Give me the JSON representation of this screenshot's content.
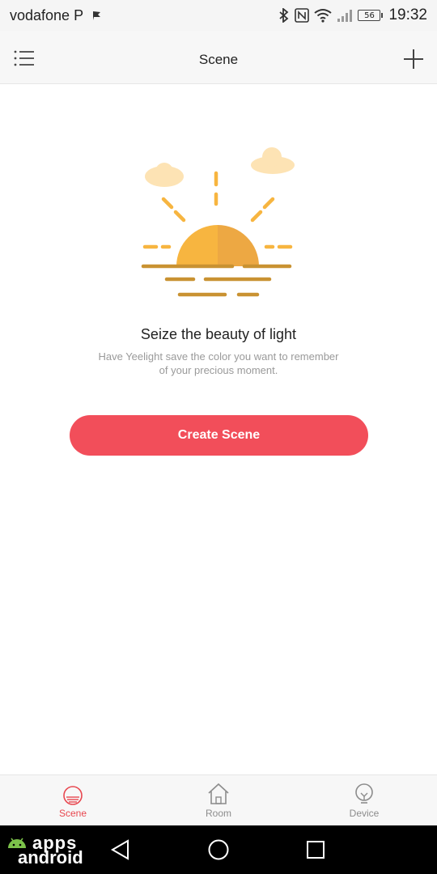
{
  "status_bar": {
    "carrier": "vodafone P",
    "battery_level": "56",
    "time": "19:32"
  },
  "header": {
    "title": "Scene",
    "menu_icon": "hamburger-menu-icon",
    "add_icon": "plus-icon"
  },
  "empty_state": {
    "illustration": "sunset-icon",
    "headline": "Seize the beauty of light",
    "description": "Have Yeelight save the color you want to remember of your precious moment."
  },
  "primary_action": {
    "label": "Create Scene"
  },
  "colors": {
    "accent": "#f24e5a",
    "active_tab": "#e8474f",
    "sun": "#f7b540",
    "sun_shade": "#eda843",
    "horizon": "#c99232",
    "cloud": "#fde3b4"
  },
  "tabs": [
    {
      "label": "Scene",
      "icon": "scene-icon",
      "active": true
    },
    {
      "label": "Room",
      "icon": "house-icon",
      "active": false
    },
    {
      "label": "Device",
      "icon": "bulb-icon",
      "active": false
    }
  ],
  "watermark": {
    "line1": "apps",
    "line2": "android"
  }
}
